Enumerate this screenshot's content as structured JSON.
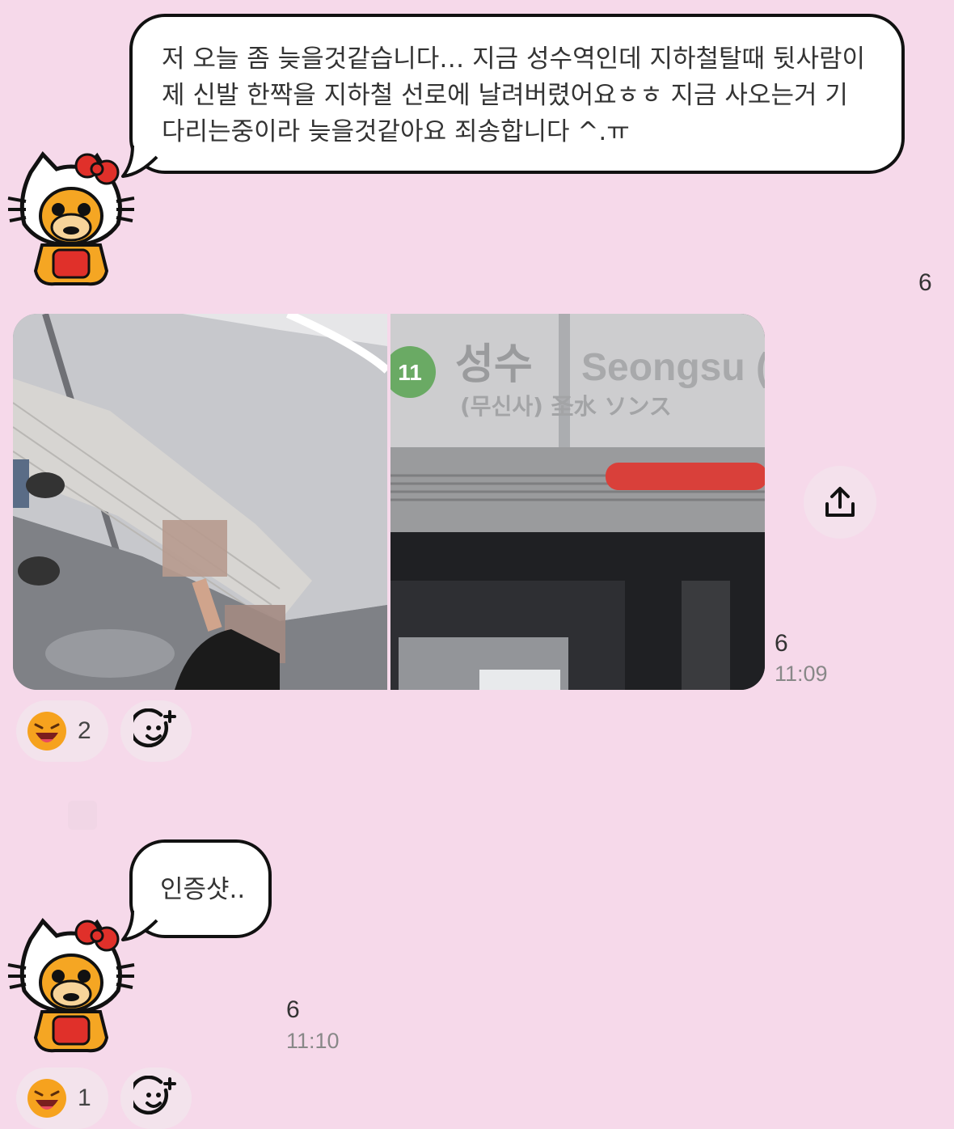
{
  "messages": [
    {
      "text_lines": [
        "저 오늘 좀 늦을것같습니다… 지금 성수역인데 지하철탈때 뒷사람이",
        "제 신발 한짝을 지하철 선로에 날려버렸어요ㅎㅎ 지금 사오는거 기",
        "다리는중이라 늦을것같아요 죄송합니다 ^.ㅠ"
      ],
      "unread": "6"
    },
    {
      "photo_sign": {
        "line_no": "11",
        "station_kr": "성수",
        "station_en": "Seongsu (",
        "sub": "(무신사)  圣水 ソンス"
      },
      "unread": "6",
      "time": "11:09",
      "reaction": {
        "count": "2"
      }
    },
    {
      "text": "인증샷..",
      "unread": "6",
      "time": "11:10",
      "reaction": {
        "count": "1"
      }
    }
  ],
  "icons": {
    "avatar": "hello-kitty-baby-milo-avatar",
    "share": "share-upload-icon",
    "reaction": "laughing-face-emoji",
    "add_reaction": "add-emoji-icon"
  },
  "colors": {
    "background": "#f6d9ea",
    "bubble_border": "#111111",
    "line_11": "#6aaa64"
  }
}
